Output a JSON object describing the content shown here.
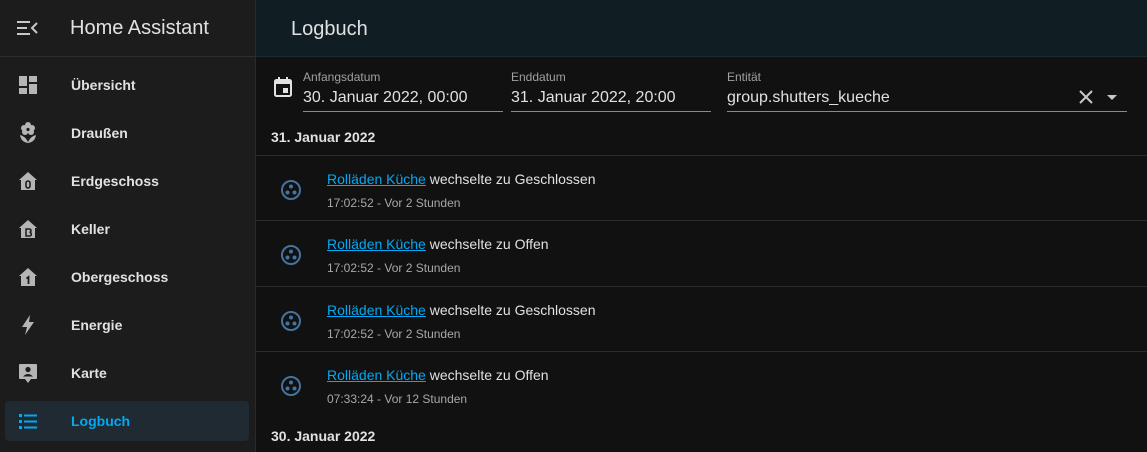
{
  "app": {
    "title": "Home Assistant"
  },
  "sidebar": {
    "items": [
      {
        "label": "Übersicht",
        "icon": "dashboard-icon"
      },
      {
        "label": "Draußen",
        "icon": "flower-icon"
      },
      {
        "label": "Erdgeschoss",
        "icon": "home-floor-0-icon"
      },
      {
        "label": "Keller",
        "icon": "home-floor-b-icon"
      },
      {
        "label": "Obergeschoss",
        "icon": "home-floor-1-icon"
      },
      {
        "label": "Energie",
        "icon": "lightning-icon"
      },
      {
        "label": "Karte",
        "icon": "map-account-icon"
      },
      {
        "label": "Logbuch",
        "icon": "format-list-icon",
        "active": true
      }
    ]
  },
  "header": {
    "title": "Logbuch"
  },
  "filters": {
    "start": {
      "label": "Anfangsdatum",
      "value": "30. Januar 2022, 00:00"
    },
    "end": {
      "label": "Enddatum",
      "value": "31. Januar 2022, 20:00"
    },
    "entity": {
      "label": "Entität",
      "value": "group.shutters_kueche"
    }
  },
  "log": {
    "day1": "31. Januar 2022",
    "day2": "30. Januar 2022",
    "entries": [
      {
        "entity": "Rolläden Küche",
        "message": "wechselte zu Geschlossen",
        "time": "17:02:52 - Vor 2 Stunden"
      },
      {
        "entity": "Rolläden Küche",
        "message": "wechselte zu Offen",
        "time": "17:02:52 - Vor 2 Stunden"
      },
      {
        "entity": "Rolläden Küche",
        "message": "wechselte zu Geschlossen",
        "time": "17:02:52 - Vor 2 Stunden"
      },
      {
        "entity": "Rolläden Küche",
        "message": "wechselte zu Offen",
        "time": "07:33:24 - Vor 12 Stunden"
      }
    ]
  },
  "colors": {
    "accent": "#03a9f4",
    "sidebar_bg": "#1c1c1c",
    "topbar_bg": "#101e24",
    "entry_icon": "#44739e"
  }
}
